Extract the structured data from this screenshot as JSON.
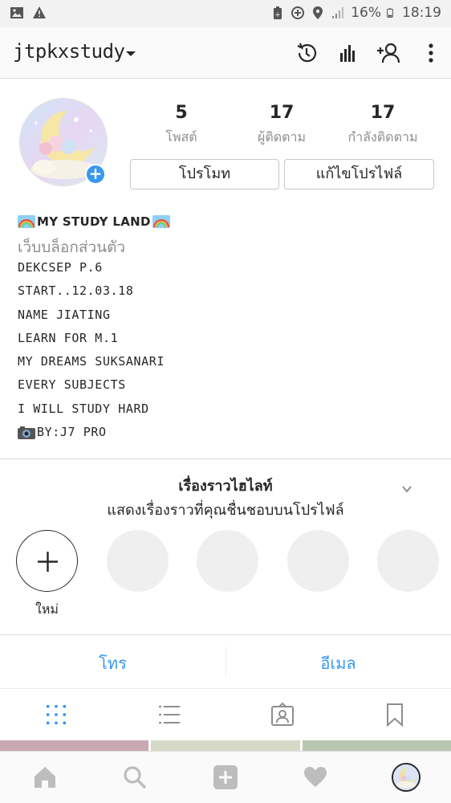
{
  "status_bar": {
    "battery": "16%",
    "time": "18:19",
    "icons": [
      "image-icon",
      "warning-icon",
      "battery-saver-icon",
      "data-saver-icon",
      "location-icon",
      "signal-icon",
      "battery-icon"
    ]
  },
  "header": {
    "username": "jtpkxstudy",
    "icons": [
      "history-icon",
      "insights-icon",
      "add-person-icon",
      "more-icon"
    ]
  },
  "stats": [
    {
      "value": "5",
      "label": "โพสต์"
    },
    {
      "value": "17",
      "label": "ผู้ติดตาม"
    },
    {
      "value": "17",
      "label": "กำลังติดตาม"
    }
  ],
  "buttons": {
    "promote": "โปรโมท",
    "edit_profile": "แก้ไขโปรไฟล์"
  },
  "bio": {
    "title": "MY STUDY LAND",
    "category": "เว็บบล็อกส่วนตัว",
    "lines": [
      "DEKCSEP P.6",
      "START..12.03.18",
      "NAME JIATING",
      "LEARN FOR M.1",
      "MY DREAMS SUKSANARI",
      "EVERY SUBJECTS",
      "I WILL STUDY HARD",
      "BY:J7 PRO"
    ]
  },
  "highlights": {
    "title": "เรื่องราวไฮไลท์",
    "subtitle": "แสดงเรื่องราวที่คุณชื่นชอบบนโปรไฟล์",
    "new_label": "ใหม่"
  },
  "contact": {
    "call": "โทร",
    "email": "อีเมล"
  },
  "colors": {
    "accent": "#3897f0",
    "text": "#262626",
    "muted": "#8e8e8e",
    "border": "#dbdbdb"
  }
}
